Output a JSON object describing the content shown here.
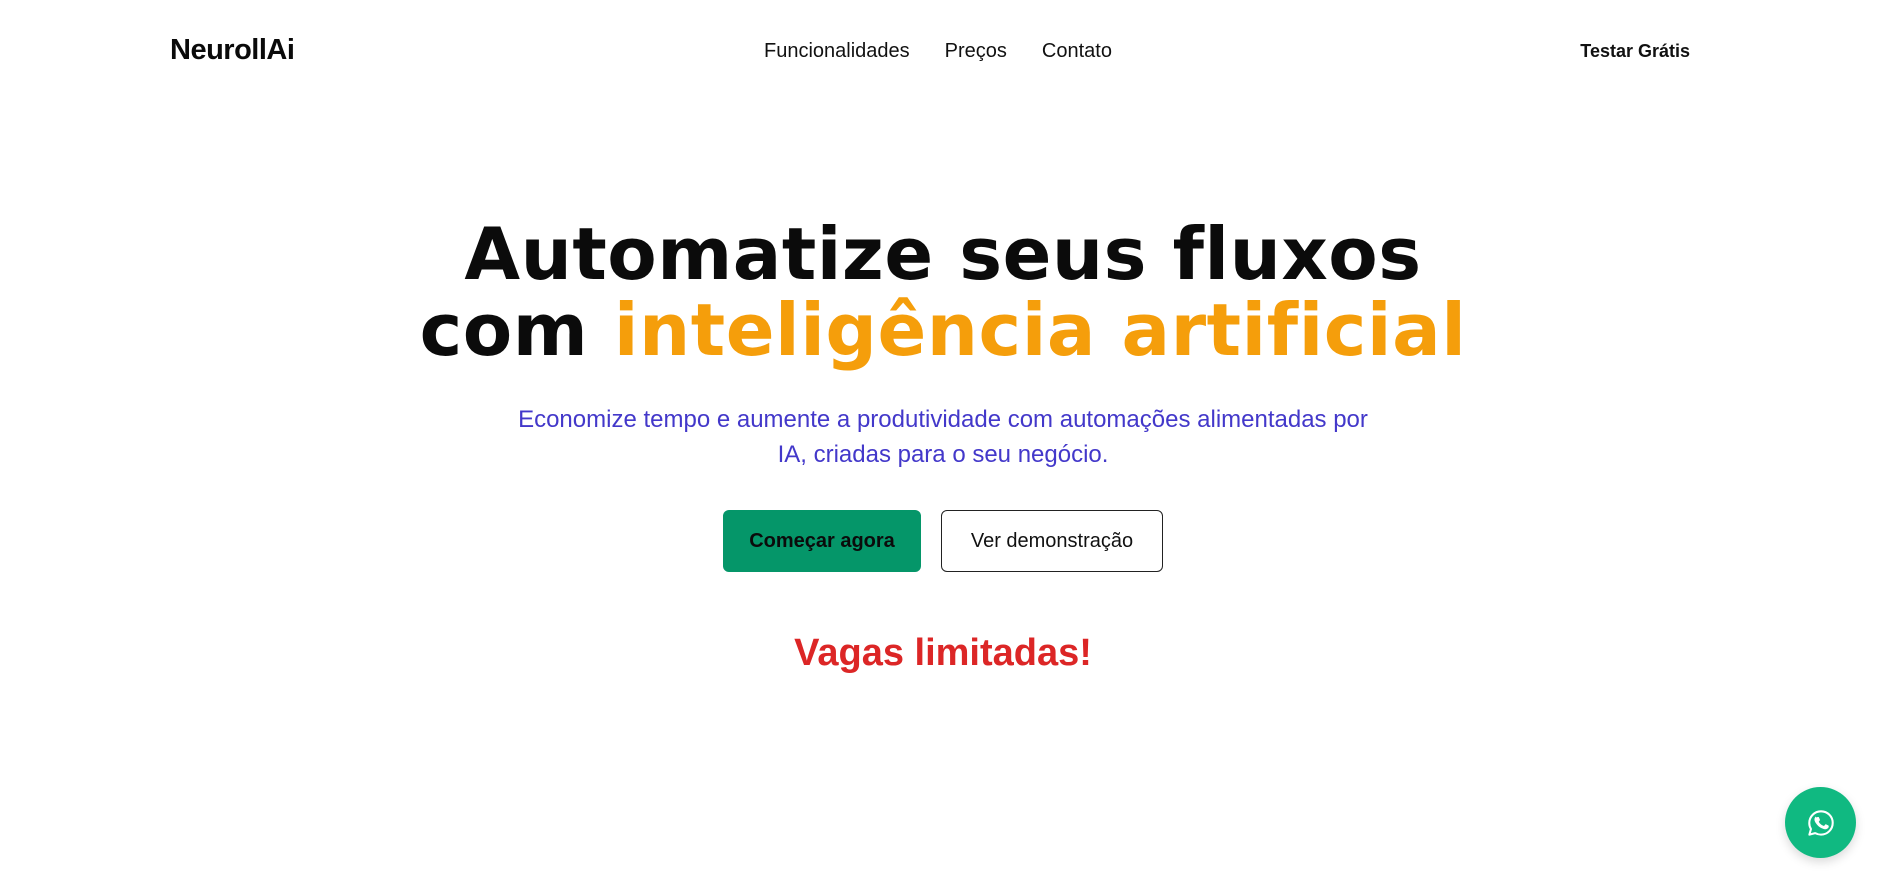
{
  "header": {
    "logo": "NeurollAi",
    "nav": [
      {
        "label": "Funcionalidades"
      },
      {
        "label": "Preços"
      },
      {
        "label": "Contato"
      }
    ],
    "cta_label": "Testar Grátis"
  },
  "hero": {
    "headline_line1": "Automatize seus fluxos",
    "headline_line2_prefix": "com ",
    "headline_line2_accent": "inteligência artificial",
    "subtitle": "Economize tempo e aumente a produtividade com automações alimentadas por IA, criadas para o seu negócio.",
    "primary_button": "Começar agora",
    "secondary_button": "Ver demonstração",
    "limited_text": "Vagas limitadas!"
  },
  "floating": {
    "icon": "whatsapp-icon"
  },
  "colors": {
    "accent": "#f59e0b",
    "subtitle": "#4338ca",
    "primary_button": "#059669",
    "limited": "#dc2626",
    "whatsapp": "#10b981"
  }
}
